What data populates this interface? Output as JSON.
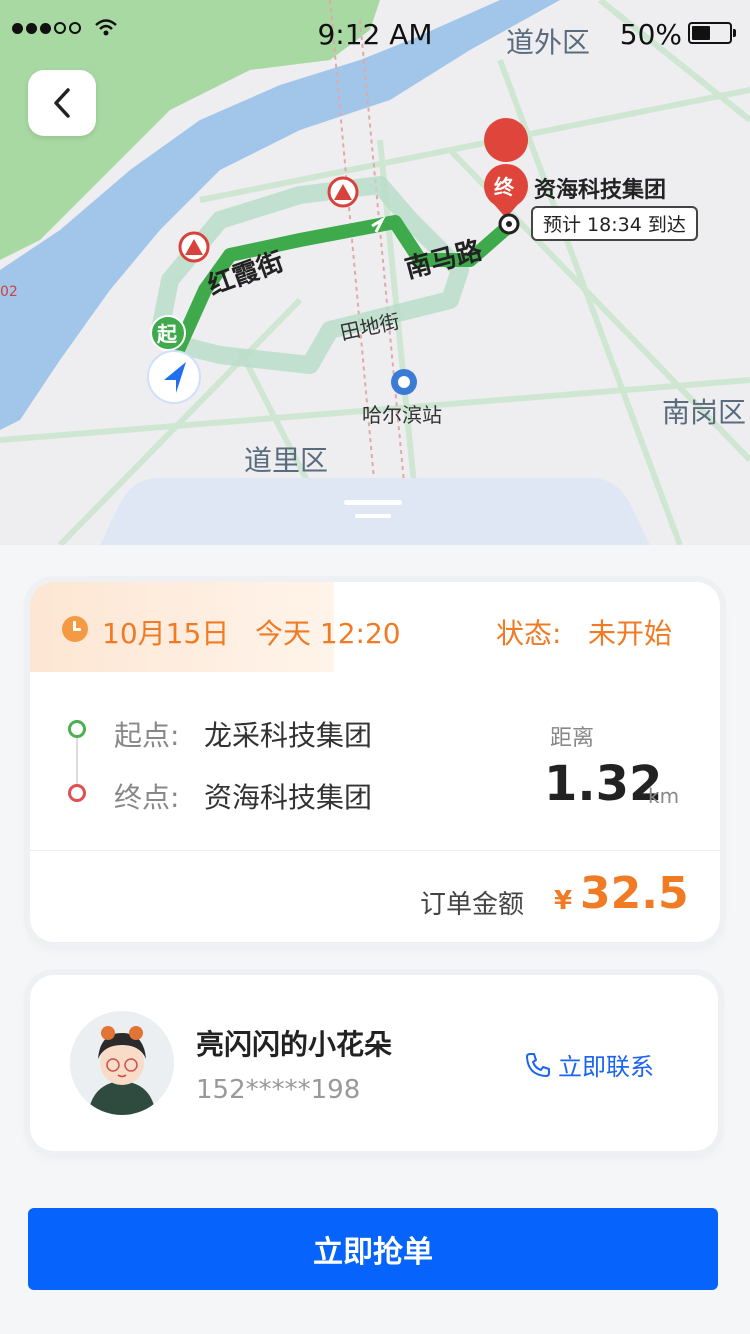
{
  "status_bar": {
    "time": "9:12 AM",
    "battery": "50%"
  },
  "map": {
    "district_labels": [
      "道外区",
      "南岗区",
      "道里区"
    ],
    "road_labels": [
      "红霞街",
      "南马路",
      "田地街"
    ],
    "station_label": "哈尔滨站",
    "start_marker": "起",
    "end_marker": "终",
    "destination_name": "资海科技集团",
    "eta": "预计 18:34 到达",
    "edge_label": "02"
  },
  "order": {
    "date": "10月15日",
    "today": "今天 12:20",
    "status_label": "状态:",
    "status_value": "未开始",
    "start_label": "起点:",
    "start_value": "龙采科技集团",
    "end_label": "终点:",
    "end_value": "资海科技集团",
    "distance_label": "距离",
    "distance_value": "1.32",
    "distance_unit": "km",
    "amount_label": "订单金额",
    "amount_currency": "¥",
    "amount_value": "32.5"
  },
  "user": {
    "name": "亮闪闪的小花朵",
    "phone": "152*****198",
    "contact_label": "立即联系"
  },
  "action": {
    "grab_label": "立即抢单"
  },
  "colors": {
    "accent": "#0663fb",
    "orange": "#f07b24",
    "route": "#4caf50"
  }
}
